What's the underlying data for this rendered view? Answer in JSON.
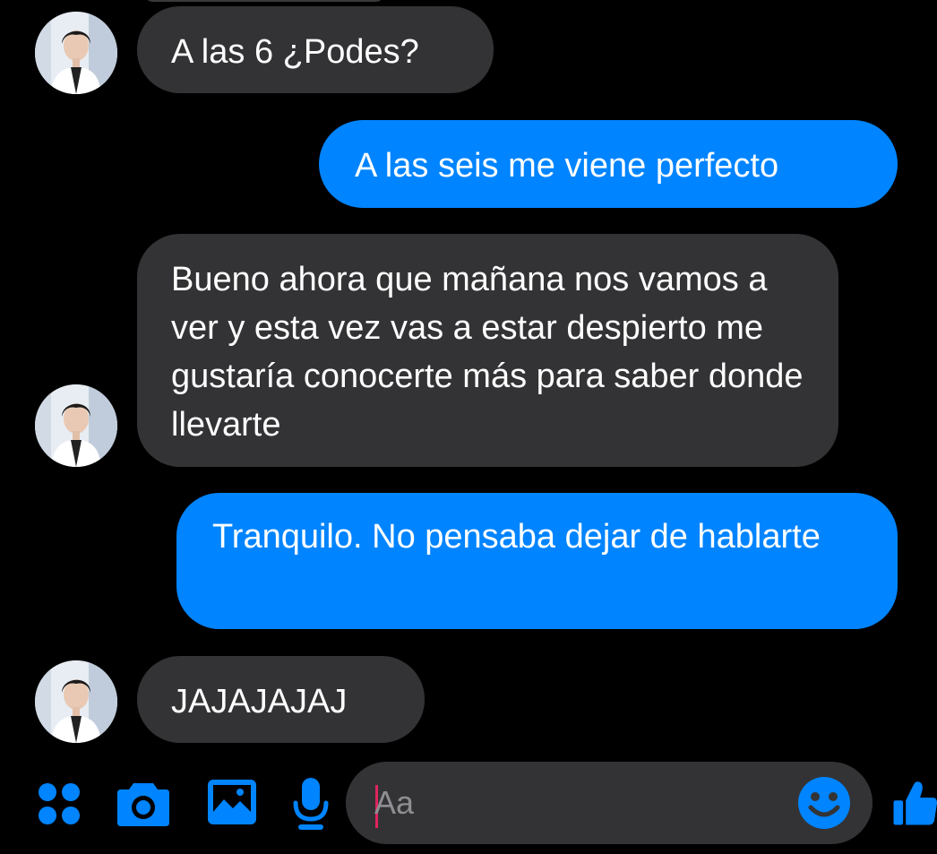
{
  "theme": {
    "background": "#000000",
    "incoming_bubble": "#333335",
    "outgoing_bubble": "#0084ff",
    "accent": "#0084ff",
    "text": "#ffffff",
    "placeholder": "#8e8e93",
    "caret": "#e0245e"
  },
  "messages": [
    {
      "direction": "incoming",
      "text": "A las 6 ¿Podes?",
      "avatar": true
    },
    {
      "direction": "outgoing",
      "text": "A las seis me viene perfecto"
    },
    {
      "direction": "incoming",
      "text": "Bueno ahora que mañana nos vamos a ver y esta vez vas a estar despierto me gustaría conocerte más para saber donde llevarte",
      "avatar": true
    },
    {
      "direction": "outgoing",
      "text": "Tranquilo. No pensaba dejar de hablarte"
    },
    {
      "direction": "incoming",
      "text": "JAJAJAJAJ",
      "avatar": true
    }
  ],
  "composer": {
    "placeholder": "Aa",
    "value": "",
    "icons": {
      "menu": "four-dots-icon",
      "camera": "camera-icon",
      "gallery": "image-icon",
      "voice": "microphone-icon",
      "emoji": "smiley-icon",
      "like": "thumbs-up-icon"
    }
  }
}
